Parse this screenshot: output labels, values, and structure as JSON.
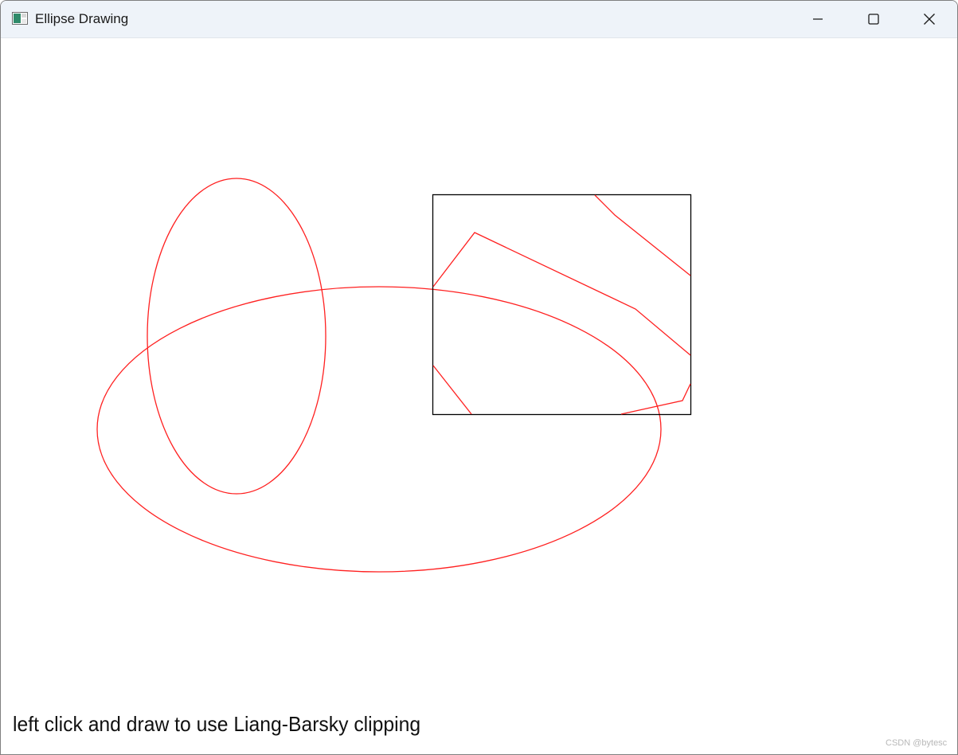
{
  "window": {
    "title": "Ellipse Drawing",
    "app_icon": "window-app-icon",
    "controls": {
      "minimize_icon": "minimize-icon",
      "maximize_icon": "maximize-icon",
      "close_icon": "close-icon"
    }
  },
  "canvas": {
    "instruction": "left click and draw to use Liang-Barsky clipping",
    "watermark": "CSDN @bytesc",
    "colors": {
      "shape_stroke": "#ff2020",
      "clip_rect_stroke": "#000000",
      "background": "#ffffff"
    }
  }
}
